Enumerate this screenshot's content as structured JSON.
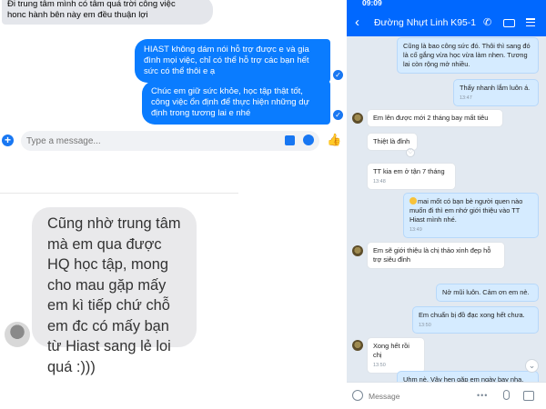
{
  "messenger": {
    "incoming_message": "Đi trung tâm mình có tâm quá trời công việc\nhonc hành bên này em đều thuận lợi",
    "outgoing_messages": [
      "HIAST không dám nói hỗ trợ được e và gia đình mọi việc, chỉ có thể hỗ trợ các bạn hết sức có thể thôi e ạ",
      "Chúc em giữ sức khỏe, học tập thật tốt, công việc ổn định để thực hiện  những dự định trong tương lai e nhé"
    ],
    "composer_placeholder": "Type a message..."
  },
  "large_message": {
    "text": "Cũng nhờ trung tâm mà em qua được HQ học tập, mong cho mau gặp mấy em kì tiếp chứ chỗ em đc có mấy bạn từ Hiast sang lẻ loi quá :)))"
  },
  "zalo": {
    "status_time": "09:09",
    "contact_name": "Đường Nhựt Linh  K95-1",
    "composer_placeholder": "Message",
    "messages": [
      {
        "dir": "out",
        "text": "Cũng là bao công sức đó. Thôi thì sang đó là cố gắng vừa học vừa làm nhen. Tương lai còn rộng mở nhiều.",
        "time": ""
      },
      {
        "dir": "out",
        "text": "Thấy nhanh lắm luôn á.",
        "time": "13:47"
      },
      {
        "dir": "in",
        "text": "Em lên được mới 2 tháng bay mất tiêu",
        "time": ""
      },
      {
        "dir": "in",
        "text": "Thiệt là đỉnh",
        "time": ""
      },
      {
        "dir": "in",
        "text": "TT kia em ở tận 7 tháng",
        "time": "13:48"
      },
      {
        "dir": "out",
        "text": "mai mốt có bạn bè người quen nào muốn đi thì em nhớ giới thiệu vào TT Hiast mình nhé.",
        "time": "13:49"
      },
      {
        "dir": "in",
        "text": "Em sẽ giới thiệu là chị thảo xinh đẹp hỗ trợ siêu đỉnh",
        "time": ""
      },
      {
        "dir": "out",
        "text": "Nở mũi luôn. Cảm ơn em nè.",
        "time": ""
      },
      {
        "dir": "out",
        "text": "Em chuẩn bị đồ đạc xong hết chưa.",
        "time": "13:50"
      },
      {
        "dir": "in",
        "text": "Xong hết rồi chị",
        "time": "13:50"
      },
      {
        "dir": "out",
        "text": "Uhm nè. Vậy hẹn gặp em ngày bay nha.",
        "time": ""
      }
    ]
  },
  "colors": {
    "messenger_blue": "#0a7cff",
    "zalo_blue": "#0068ff",
    "zalo_background": "#e2e9f1",
    "zalo_outgoing_bubble": "#d5ebff"
  }
}
